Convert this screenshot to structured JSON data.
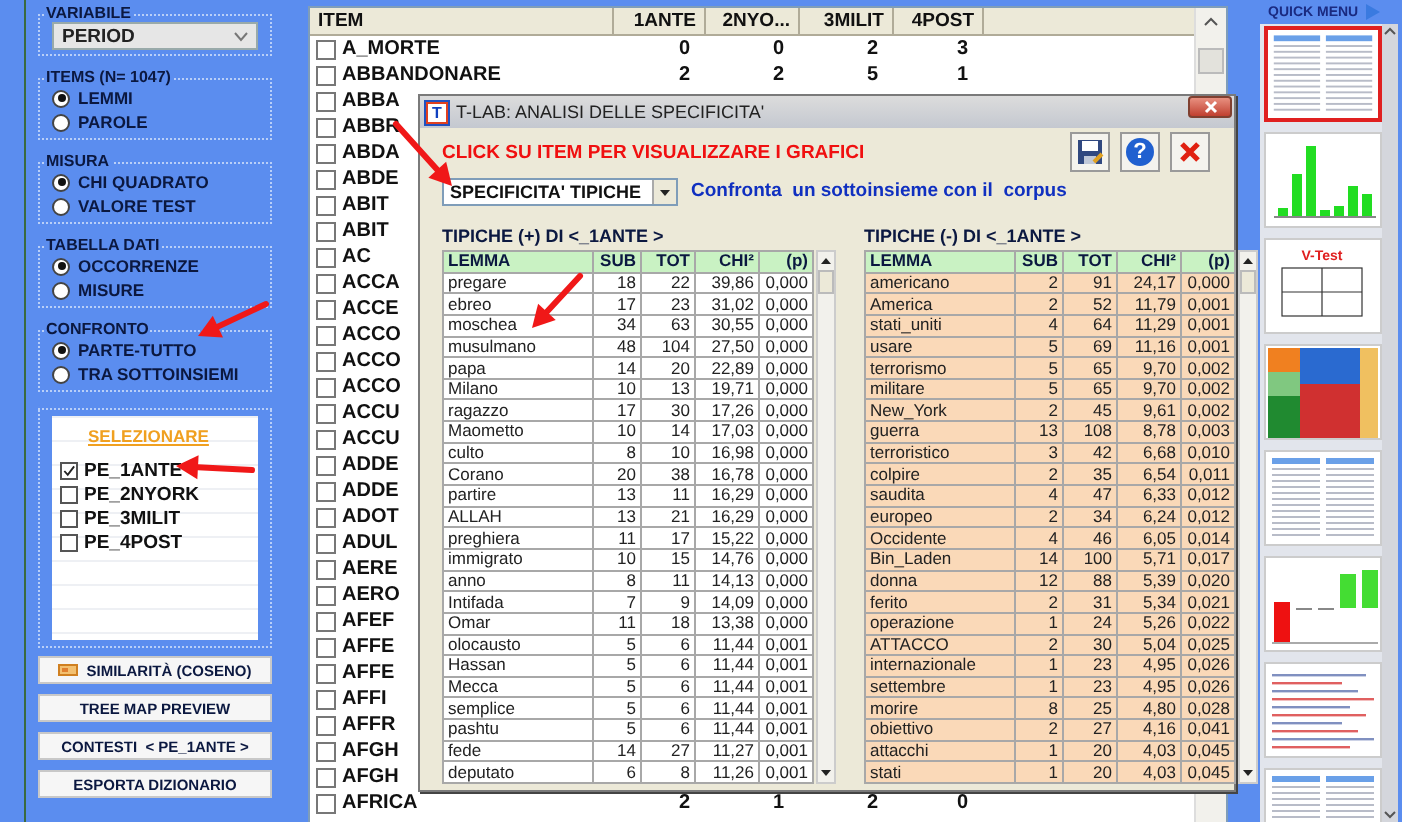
{
  "left_panel": {
    "variable": {
      "label": "VARIABILE",
      "value": "PERIOD"
    },
    "groups": [
      {
        "label": "ITEMS (N= 1047)",
        "options": [
          {
            "label": "LEMMI",
            "selected": true
          },
          {
            "label": "PAROLE",
            "selected": false
          }
        ]
      },
      {
        "label": "MISURA",
        "options": [
          {
            "label": "CHI QUADRATO",
            "selected": true
          },
          {
            "label": "VALORE TEST",
            "selected": false
          }
        ]
      },
      {
        "label": "TABELLA DATI",
        "options": [
          {
            "label": "OCCORRENZE",
            "selected": true
          },
          {
            "label": "MISURE",
            "selected": false
          }
        ]
      },
      {
        "label": "CONFRONTO",
        "options": [
          {
            "label": "PARTE-TUTTO",
            "selected": true
          },
          {
            "label": "TRA SOTTOINSIEMI",
            "selected": false
          }
        ]
      }
    ],
    "selection": {
      "title": "SELEZIONARE",
      "items": [
        {
          "label": "PE_1ANTE",
          "checked": true
        },
        {
          "label": "PE_2NYORK",
          "checked": false
        },
        {
          "label": "PE_3MILIT",
          "checked": false
        },
        {
          "label": "PE_4POST",
          "checked": false
        }
      ]
    },
    "buttons": [
      {
        "label": "SIMILARITÀ (COSENO)",
        "kind": "icon"
      },
      {
        "label": "TREE MAP PREVIEW",
        "kind": "plain"
      },
      {
        "label": "CONTESTI  < PE_1ANTE >",
        "kind": "plain"
      },
      {
        "label": "ESPORTA DIZIONARIO",
        "kind": "plain"
      }
    ]
  },
  "items_table": {
    "columns": [
      "ITEM",
      "1ANTE",
      "2NYO...",
      "3MILIT",
      "4POST"
    ],
    "rows": [
      {
        "item": "A_MORTE",
        "checked": false,
        "values": [
          "0",
          "0",
          "2",
          "3"
        ]
      },
      {
        "item": "ABBANDONARE",
        "checked": false,
        "values": [
          "2",
          "2",
          "5",
          "1"
        ]
      },
      {
        "item": "ABBA",
        "checked": false
      },
      {
        "item": "ABBR",
        "checked": false
      },
      {
        "item": "ABDA",
        "checked": false
      },
      {
        "item": "ABDE",
        "checked": false
      },
      {
        "item": "ABIT",
        "checked": false
      },
      {
        "item": "ABIT",
        "checked": false
      },
      {
        "item": "AC",
        "checked": false
      },
      {
        "item": "ACCA",
        "checked": false
      },
      {
        "item": "ACCE",
        "checked": false
      },
      {
        "item": "ACCO",
        "checked": false
      },
      {
        "item": "ACCO",
        "checked": false
      },
      {
        "item": "ACCO",
        "checked": false
      },
      {
        "item": "ACCU",
        "checked": false
      },
      {
        "item": "ACCU",
        "checked": false
      },
      {
        "item": "ADDE",
        "checked": false
      },
      {
        "item": "ADDE",
        "checked": false
      },
      {
        "item": "ADOT",
        "checked": false
      },
      {
        "item": "ADUL",
        "checked": false
      },
      {
        "item": "AERE",
        "checked": false
      },
      {
        "item": "AERO",
        "checked": false
      },
      {
        "item": "AFEF",
        "checked": false
      },
      {
        "item": "AFFE",
        "checked": false
      },
      {
        "item": "AFFE",
        "checked": false
      },
      {
        "item": "AFFI",
        "checked": false
      },
      {
        "item": "AFFR",
        "checked": false
      },
      {
        "item": "AFGH",
        "checked": false
      },
      {
        "item": "AFGH",
        "checked": false
      },
      {
        "item": "AFRICA",
        "checked": false,
        "values": [
          "2",
          "1",
          "2",
          "0"
        ]
      }
    ]
  },
  "dialog": {
    "icon_text": "T",
    "title": "T-LAB: ANALISI DELLE SPECIFICITA'",
    "instruction": "CLICK SU ITEM PER VISUALIZZARE I GRAFICI",
    "tools": [
      {
        "kind": "save"
      },
      {
        "kind": "help",
        "glyph": "?"
      },
      {
        "kind": "close"
      }
    ],
    "mode": "SPECIFICITA' TIPICHE",
    "mode_hint": "Confronta  un sottoinsieme con il  corpus",
    "tables": [
      {
        "kind": "plus",
        "title": "TIPICHE (+) DI <_1ANTE >",
        "columns": [
          "LEMMA",
          "SUB",
          "TOT",
          "CHI²",
          "(p)"
        ],
        "rows": [
          [
            "pregare",
            "18",
            "22",
            "39,86",
            "0,000"
          ],
          [
            "ebreo",
            "17",
            "23",
            "31,02",
            "0,000"
          ],
          [
            "moschea",
            "34",
            "63",
            "30,55",
            "0,000"
          ],
          [
            "musulmano",
            "48",
            "104",
            "27,50",
            "0,000"
          ],
          [
            "papa",
            "14",
            "20",
            "22,89",
            "0,000"
          ],
          [
            "Milano",
            "10",
            "13",
            "19,71",
            "0,000"
          ],
          [
            "ragazzo",
            "17",
            "30",
            "17,26",
            "0,000"
          ],
          [
            "Maometto",
            "10",
            "14",
            "17,03",
            "0,000"
          ],
          [
            "culto",
            "8",
            "10",
            "16,98",
            "0,000"
          ],
          [
            "Corano",
            "20",
            "38",
            "16,78",
            "0,000"
          ],
          [
            "partire",
            "13",
            "11",
            "16,29",
            "0,000"
          ],
          [
            "ALLAH",
            "13",
            "21",
            "16,29",
            "0,000"
          ],
          [
            "preghiera",
            "11",
            "17",
            "15,22",
            "0,000"
          ],
          [
            "immigrato",
            "10",
            "15",
            "14,76",
            "0,000"
          ],
          [
            "anno",
            "8",
            "11",
            "14,13",
            "0,000"
          ],
          [
            "Intifada",
            "7",
            "9",
            "14,09",
            "0,000"
          ],
          [
            "Omar",
            "11",
            "18",
            "13,38",
            "0,000"
          ],
          [
            "olocausto",
            "5",
            "6",
            "11,44",
            "0,001"
          ],
          [
            "Hassan",
            "5",
            "6",
            "11,44",
            "0,001"
          ],
          [
            "Mecca",
            "5",
            "6",
            "11,44",
            "0,001"
          ],
          [
            "semplice",
            "5",
            "6",
            "11,44",
            "0,001"
          ],
          [
            "pashtu",
            "5",
            "6",
            "11,44",
            "0,001"
          ],
          [
            "fede",
            "14",
            "27",
            "11,27",
            "0,001"
          ],
          [
            "deputato",
            "6",
            "8",
            "11,26",
            "0,001"
          ]
        ]
      },
      {
        "kind": "minus",
        "title": "TIPICHE (-) DI <_1ANTE >",
        "columns": [
          "LEMMA",
          "SUB",
          "TOT",
          "CHI²",
          "(p)"
        ],
        "rows": [
          [
            "americano",
            "2",
            "91",
            "24,17",
            "0,000"
          ],
          [
            "America",
            "2",
            "52",
            "11,79",
            "0,001"
          ],
          [
            "stati_uniti",
            "4",
            "64",
            "11,29",
            "0,001"
          ],
          [
            "usare",
            "5",
            "69",
            "11,16",
            "0,001"
          ],
          [
            "terrorismo",
            "5",
            "65",
            "9,70",
            "0,002"
          ],
          [
            "militare",
            "5",
            "65",
            "9,70",
            "0,002"
          ],
          [
            "New_York",
            "2",
            "45",
            "9,61",
            "0,002"
          ],
          [
            "guerra",
            "13",
            "108",
            "8,78",
            "0,003"
          ],
          [
            "terroristico",
            "3",
            "42",
            "6,68",
            "0,010"
          ],
          [
            "colpire",
            "2",
            "35",
            "6,54",
            "0,011"
          ],
          [
            "saudita",
            "4",
            "47",
            "6,33",
            "0,012"
          ],
          [
            "europeo",
            "2",
            "34",
            "6,24",
            "0,012"
          ],
          [
            "Occidente",
            "4",
            "46",
            "6,05",
            "0,014"
          ],
          [
            "Bin_Laden",
            "14",
            "100",
            "5,71",
            "0,017"
          ],
          [
            "donna",
            "12",
            "88",
            "5,39",
            "0,020"
          ],
          [
            "ferito",
            "2",
            "31",
            "5,34",
            "0,021"
          ],
          [
            "operazione",
            "1",
            "24",
            "5,26",
            "0,022"
          ],
          [
            "ATTACCO",
            "2",
            "30",
            "5,04",
            "0,025"
          ],
          [
            "internazionale",
            "1",
            "23",
            "4,95",
            "0,026"
          ],
          [
            "settembre",
            "1",
            "23",
            "4,95",
            "0,026"
          ],
          [
            "morire",
            "8",
            "25",
            "4,80",
            "0,028"
          ],
          [
            "obiettivo",
            "2",
            "27",
            "4,16",
            "0,041"
          ],
          [
            "attacchi",
            "1",
            "20",
            "4,03",
            "0,045"
          ],
          [
            "stati",
            "1",
            "20",
            "4,03",
            "0,045"
          ]
        ]
      }
    ]
  },
  "quick_menu": {
    "title": "QUICK MENU",
    "thumbnails": [
      {
        "kind": "table",
        "selected": true
      },
      {
        "kind": "bars",
        "selected": false
      },
      {
        "kind": "quadrant",
        "label": "V-Test",
        "selected": false
      },
      {
        "kind": "treemap",
        "selected": false
      },
      {
        "kind": "table",
        "selected": false
      },
      {
        "kind": "columns",
        "selected": false
      },
      {
        "kind": "text",
        "selected": false
      },
      {
        "kind": "table",
        "selected": false
      }
    ]
  },
  "pointer_arrows": [
    {
      "kind": "arrow"
    },
    {
      "kind": "arrow"
    },
    {
      "kind": "arrow"
    },
    {
      "kind": "arrow"
    }
  ]
}
